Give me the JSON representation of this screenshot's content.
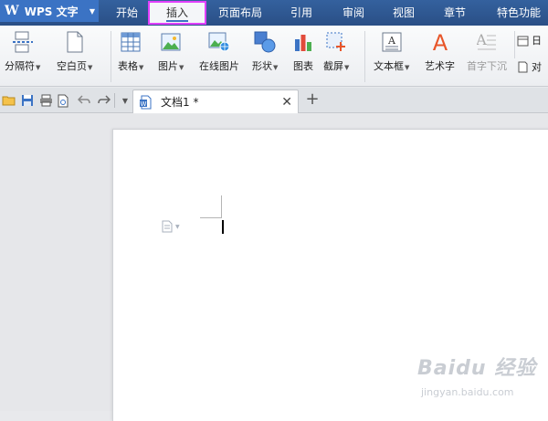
{
  "app": {
    "name": "WPS 文字"
  },
  "menu": {
    "tabs": [
      {
        "label": "开始"
      },
      {
        "label": "插入"
      },
      {
        "label": "页面布局"
      },
      {
        "label": "引用"
      },
      {
        "label": "审阅"
      },
      {
        "label": "视图"
      },
      {
        "label": "章节"
      },
      {
        "label": "特色功能"
      }
    ],
    "active_tab": "插入"
  },
  "ribbon": {
    "items": [
      {
        "label": "分隔符",
        "icon": "page-break-icon",
        "dropdown": true
      },
      {
        "label": "空白页",
        "icon": "blank-page-icon",
        "dropdown": true
      },
      {
        "label": "表格",
        "icon": "table-icon",
        "dropdown": true
      },
      {
        "label": "图片",
        "icon": "picture-icon",
        "dropdown": true
      },
      {
        "label": "在线图片",
        "icon": "online-picture-icon",
        "dropdown": false
      },
      {
        "label": "形状",
        "icon": "shapes-icon",
        "dropdown": true
      },
      {
        "label": "图表",
        "icon": "chart-icon",
        "dropdown": false
      },
      {
        "label": "截屏",
        "icon": "screenshot-icon",
        "dropdown": true
      },
      {
        "label": "文本框",
        "icon": "textbox-icon",
        "dropdown": true
      },
      {
        "label": "艺术字",
        "icon": "wordart-icon",
        "dropdown": false
      },
      {
        "label": "首字下沉",
        "icon": "drop-cap-icon",
        "dropdown": false,
        "disabled": true
      }
    ],
    "right_small": [
      {
        "label": "日",
        "icon": "date-icon"
      },
      {
        "label": "对",
        "icon": "object-icon"
      }
    ]
  },
  "document": {
    "tab_name": "文档1 *",
    "new_tab_symbol": "+",
    "close_symbol": "✕"
  },
  "watermark": {
    "logo": "Baidu 经验",
    "url": "jingyan.baidu.com"
  },
  "colors": {
    "menu_bar": "#2a4f86",
    "app_button": "#3b73c4",
    "active_tab_highlight": "#e040fb",
    "wordart_orange": "#e8562a"
  }
}
